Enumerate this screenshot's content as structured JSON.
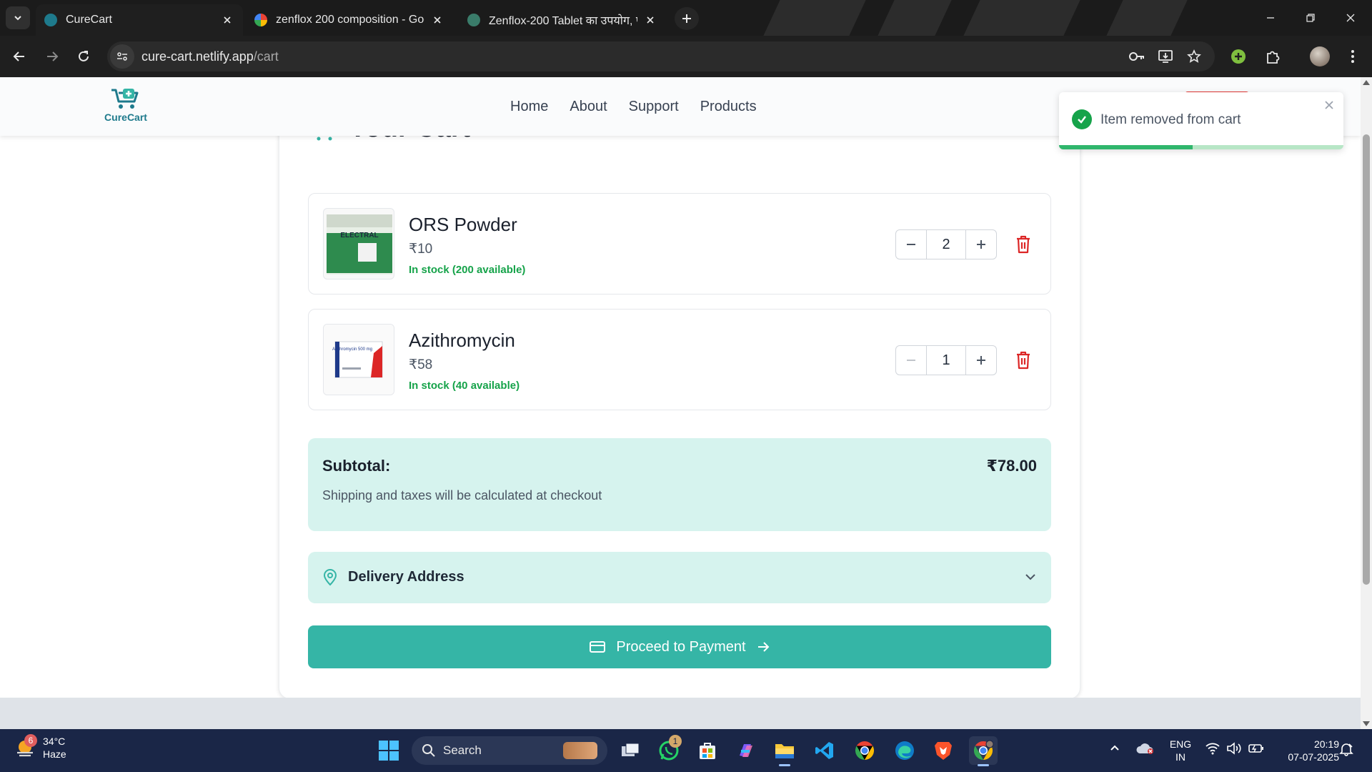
{
  "browser": {
    "tabs": [
      {
        "title": "CureCart",
        "active": true
      },
      {
        "title": "zenflox 200 composition - Goo",
        "active": false
      },
      {
        "title": "Zenflox-200 Tablet का उपयोग, प",
        "active": false
      }
    ],
    "url_host": "cure-cart.netlify.app",
    "url_path": "/cart"
  },
  "header": {
    "logo_text": "CureCart",
    "nav": [
      "Home",
      "About",
      "Support",
      "Products"
    ]
  },
  "toast": {
    "message": "Item removed from cart",
    "progress_fraction": 0.47,
    "color": "#16a34a"
  },
  "cart": {
    "title": "Your Cart",
    "items": [
      {
        "name": "ORS Powder",
        "price": "₹10",
        "stock": "In stock (200 available)",
        "quantity": "2",
        "image_label": "ELECTRAL"
      },
      {
        "name": "Azithromycin",
        "price": "₹58",
        "stock": "In stock (40 available)",
        "quantity": "1",
        "image_label": "Azithromycin 500 mg"
      }
    ],
    "subtotal_label": "Subtotal:",
    "subtotal_value": "₹78.00",
    "shipping_note": "Shipping and taxes will be calculated at checkout",
    "delivery_label": "Delivery Address",
    "pay_button": "Proceed to Payment"
  },
  "colors": {
    "accent": "#35b5a6",
    "panel": "#d6f3ee",
    "danger": "#dc2626",
    "stock": "#16a34a"
  },
  "taskbar": {
    "weather_temp": "34°C",
    "weather_desc": "Haze",
    "weather_badge": "6",
    "search_label": "Search",
    "whatsapp_badge": "1",
    "lang_1": "ENG",
    "lang_2": "IN",
    "time": "20:19",
    "date": "07-07-2025"
  }
}
